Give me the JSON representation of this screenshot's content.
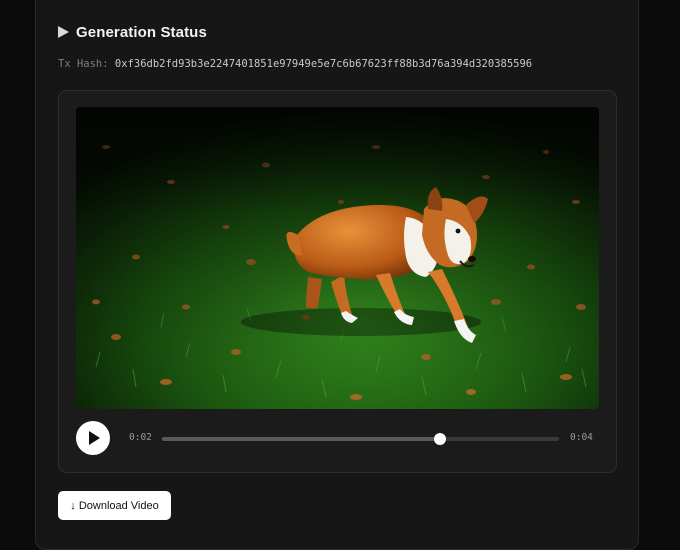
{
  "status": {
    "title": "Generation Status",
    "tx_label": "Tx Hash:",
    "tx_hash": "0xf36db2fd93b3e2247401851e97949e5e7c6b67623ff88b3d76a394d320385596"
  },
  "player": {
    "current_time": "0:02",
    "duration": "0:04",
    "progress": 0.7
  },
  "actions": {
    "download_label": "↓ Download Video"
  },
  "icons": {
    "title_icon": "play-triangle-icon",
    "play_icon": "play-icon"
  },
  "colors": {
    "background": "#0b0b0c",
    "panel": "#161617",
    "button": "#ffffff",
    "grass": "#1f6b14",
    "dog_fur": "#c96a1e"
  }
}
